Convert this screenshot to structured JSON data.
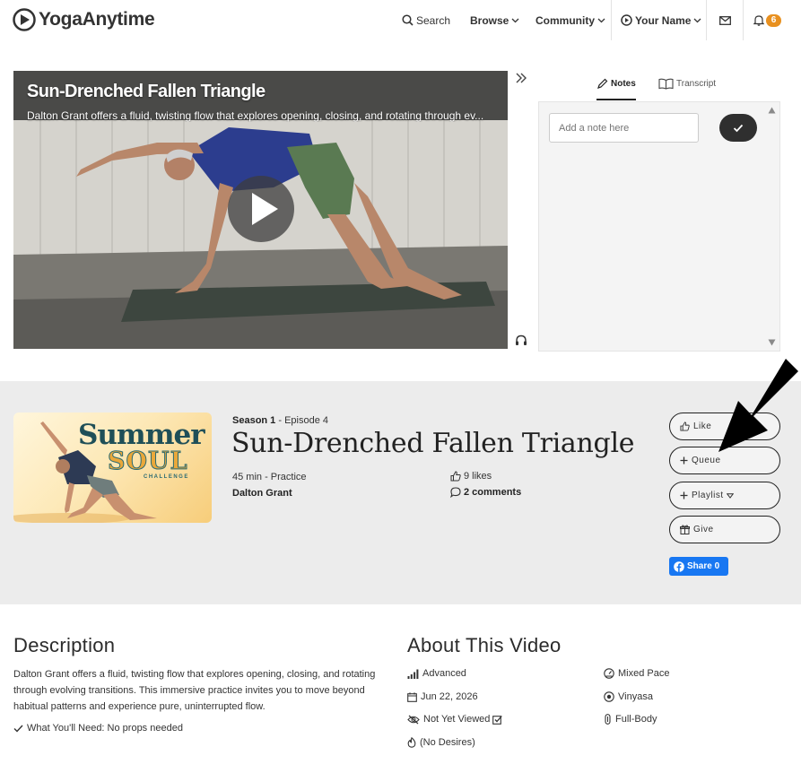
{
  "header": {
    "brand": "YogaAnytime",
    "nav": {
      "search": "Search",
      "browse": "Browse",
      "community": "Community",
      "user": "Your Name"
    },
    "notification_count": "6"
  },
  "video": {
    "title": "Sun-Drenched Fallen Triangle",
    "description_preview": "Dalton Grant offers a fluid, twisting flow that explores opening, closing, and rotating through ev..."
  },
  "notes_panel": {
    "tabs": [
      "Notes",
      "Transcript"
    ],
    "active_tab": "Notes",
    "input_placeholder": "Add a note here"
  },
  "episode": {
    "season_label": "Season 1",
    "episode_label": " - Episode 4",
    "title": "Sun-Drenched Fallen Triangle",
    "duration_type": "45 min - Practice",
    "instructor": "Dalton Grant",
    "likes": "9 likes",
    "comments": "2 comments",
    "thumbnail": {
      "line1": "Summer",
      "line2": "SOUL",
      "line3": "CHALLENGE"
    }
  },
  "actions": {
    "like": "Like",
    "queue": "Queue",
    "playlist": "Playlist",
    "give": "Give",
    "share": "Share 0"
  },
  "description": {
    "heading": "Description",
    "text": "Dalton Grant offers a fluid, twisting flow that explores opening, closing, and rotating through evolving transitions. This immersive practice invites you to move beyond habitual patterns and experience pure, uninterrupted flow.",
    "need": "What You'll Need: No props needed"
  },
  "about": {
    "heading": "About This Video",
    "level": "Advanced",
    "date": "Jun 22, 2026",
    "viewed": "Not Yet Viewed",
    "desires": "(No Desires)",
    "pace": "Mixed Pace",
    "style": "Vinyasa",
    "focus": "Full-Body"
  },
  "colors": {
    "badge": "#e8901f",
    "facebook": "#1877f2",
    "info_band": "#ececec",
    "thumbnail_teal": "#1f4f58",
    "thumbnail_gold": "#eaa83a"
  }
}
